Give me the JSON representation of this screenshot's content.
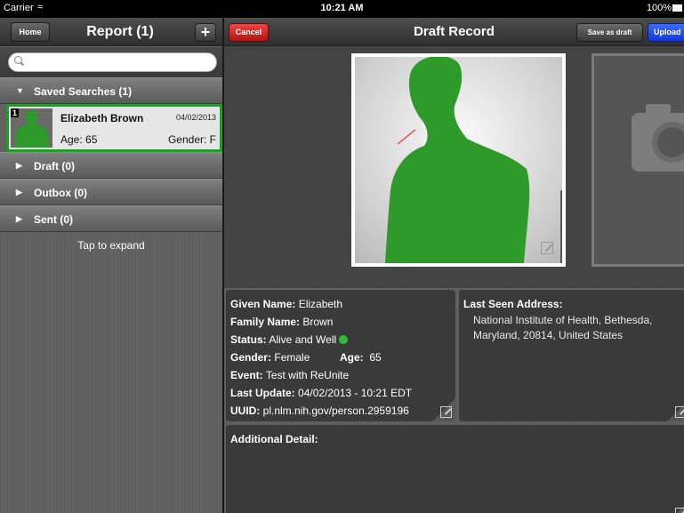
{
  "status_bar": {
    "carrier": "Carrier",
    "wifi": "≈",
    "time": "10:21 AM",
    "battery": "100%"
  },
  "left_nav": {
    "home_label": "Home",
    "title": "Report (1)",
    "add_label": "+"
  },
  "search": {
    "placeholder": "",
    "value": ""
  },
  "sections": {
    "saved": {
      "label": "Saved Searches (1)",
      "expanded": true
    },
    "draft": {
      "label": "Draft (0)"
    },
    "outbox": {
      "label": "Outbox (0)"
    },
    "sent": {
      "label": "Sent (0)"
    }
  },
  "saved_entry": {
    "index": "1",
    "name": "Elizabeth Brown",
    "date": "04/02/2013",
    "age": "Age: 65",
    "gender": "Gender: F"
  },
  "tap_hint": "Tap to expand",
  "right_nav": {
    "cancel_label": "Cancel",
    "title": "Draft Record",
    "save_draft_label": "Save as draft",
    "upload_label": "Upload"
  },
  "pager": {
    "active": "•",
    "inactive": "•"
  },
  "record": {
    "given_name_label": "Given Name:",
    "given_name": "Elizabeth",
    "family_name_label": "Family Name:",
    "family_name": "Brown",
    "status_label": "Status:",
    "status": "Alive and Well",
    "gender_label": "Gender:",
    "gender": "Female",
    "age_label": "Age:",
    "age": "65",
    "event_label": "Event:",
    "event": "Test with ReUnite",
    "last_update_label": "Last Update:",
    "last_update": "04/02/2013 - 10:21 EDT",
    "uuid_label": "UUID:",
    "uuid": "pl.nlm.nih.gov/person.2959196"
  },
  "address": {
    "label": "Last Seen Address:",
    "line1": "National Institute of Health, Bethesda,",
    "line2": "Maryland, 20814, United States"
  },
  "additional": {
    "label": "Additional Detail:"
  },
  "colors": {
    "selection_border": "#16a31d",
    "silhouette": "#2d9a2a",
    "cancel": "#d02020",
    "upload": "#1f4cf0",
    "status_dot": "#2dbd34"
  }
}
